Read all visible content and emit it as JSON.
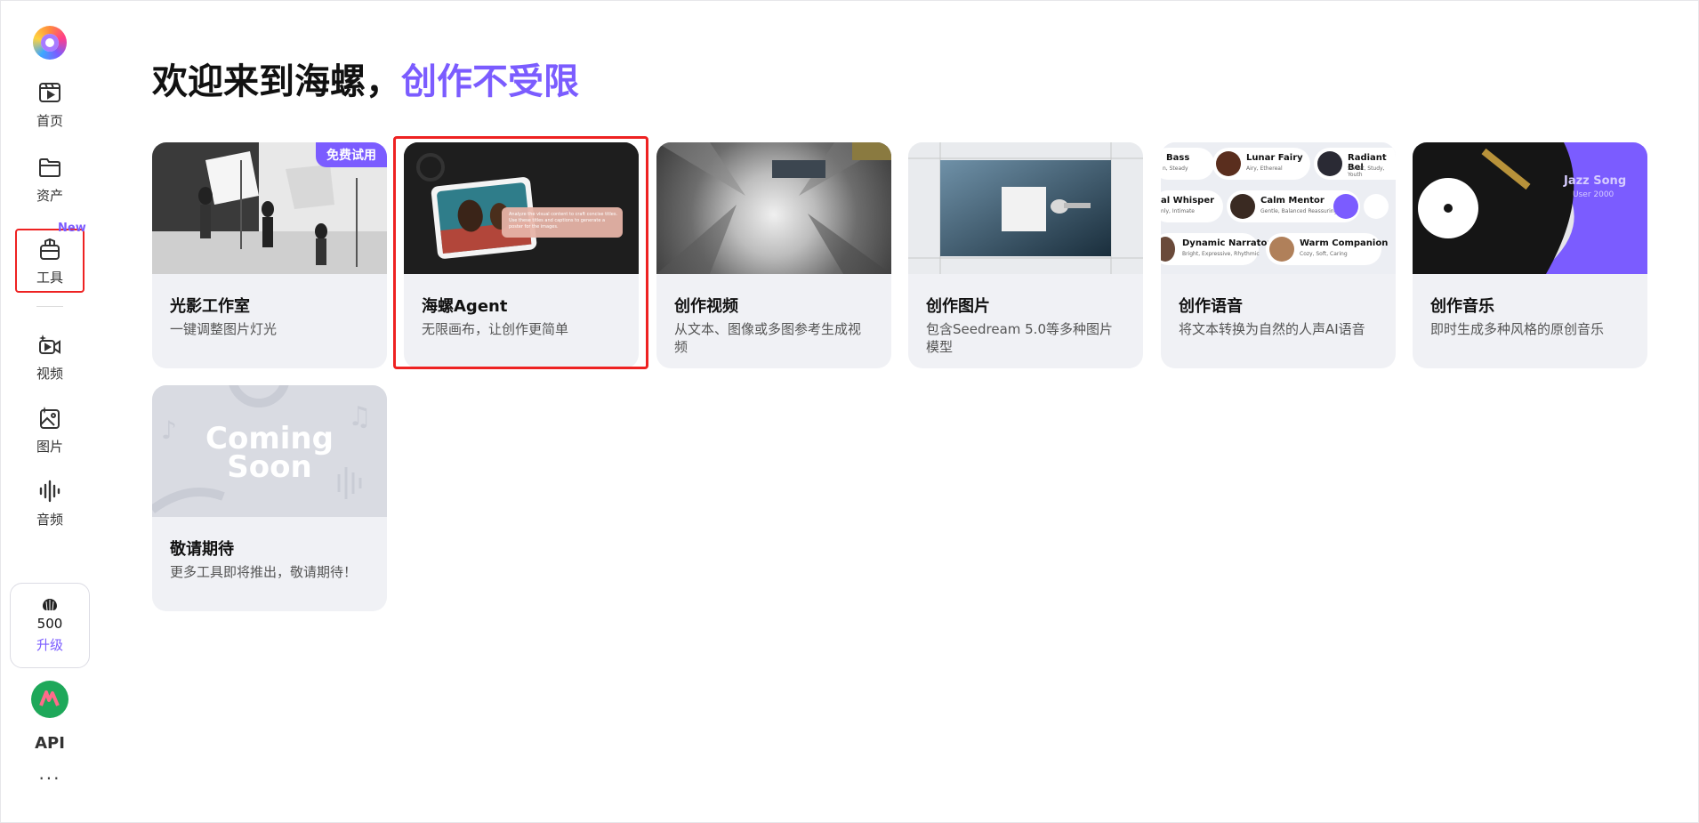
{
  "sidebar": {
    "items": [
      {
        "label": "首页",
        "icon": "play-frame-icon"
      },
      {
        "label": "资产",
        "icon": "folder-icon"
      },
      {
        "label": "工具",
        "icon": "toolbox-icon",
        "badge": "New",
        "active": true
      },
      {
        "label": "视频",
        "icon": "video-camera-icon"
      },
      {
        "label": "图片",
        "icon": "image-sparkle-icon"
      },
      {
        "label": "音频",
        "icon": "audio-wave-icon"
      }
    ],
    "credits": "500",
    "upgrade_label": "升级",
    "api_label": "API",
    "more_label": "···"
  },
  "header": {
    "title_main": "欢迎来到海螺，",
    "title_accent": "创作不受限"
  },
  "cards": [
    {
      "title": "光影工作室",
      "desc": "一键调整图片灯光",
      "badge": "免费试用"
    },
    {
      "title": "海螺Agent",
      "desc": "无限画布，让创作更简单"
    },
    {
      "title": "创作视频",
      "desc": "从文本、图像或多图参考生成视频"
    },
    {
      "title": "创作图片",
      "desc": "包含Seedream 5.0等多种图片模型"
    },
    {
      "title": "创作语音",
      "desc": "将文本转换为自然的人声AI语音"
    },
    {
      "title": "创作音乐",
      "desc": "即时生成多种风格的原创音乐"
    },
    {
      "title": "敬请期待",
      "desc": "更多工具即将推出，敬请期待！"
    }
  ],
  "thumbs": {
    "voices": [
      {
        "name": "Bass",
        "tag": "n, Steady"
      },
      {
        "name": "Lunar Fairy",
        "tag": "Airy, Ethereal"
      },
      {
        "name": "Radiant Bel",
        "tag": "Sweet, Study, Youth"
      },
      {
        "name": "al Whisper",
        "tag": "nly, Intimate"
      },
      {
        "name": "Calm Mentor",
        "tag": "Gentle, Balanced Reassuring"
      },
      {
        "name": "Dynamic Narrator",
        "tag": "Bright, Expressive, Rhythmic"
      },
      {
        "name": "Warm Companion",
        "tag": "Cozy, Soft, Caring"
      }
    ],
    "music_title": "Jazz Song",
    "music_user": "User 2000",
    "coming_soon_1": "Coming",
    "coming_soon_2": "Soon",
    "agent_caption": "Analyze the visual content to craft concise titles. Use these titles and captions to generate a poster for the images."
  },
  "colors": {
    "accent": "#7b5cff",
    "highlight": "#ee2222",
    "card_bg": "#f0f1f5"
  }
}
